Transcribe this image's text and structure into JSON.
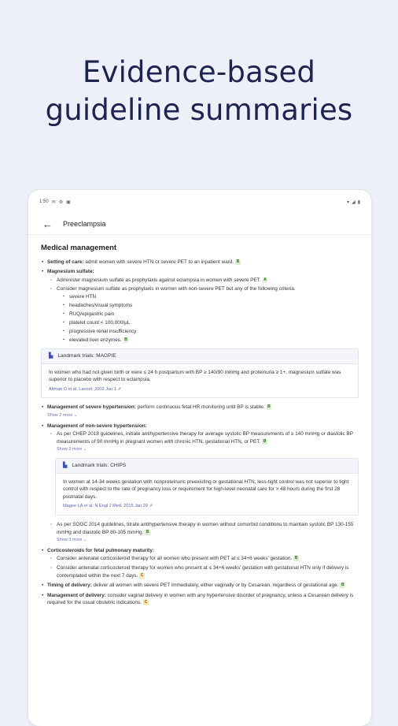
{
  "headline": {
    "line1": "Evidence-based",
    "line2": "guideline summaries"
  },
  "status": {
    "time": "1:50",
    "icons_left": [
      "mail-icon",
      "settings-icon",
      "image-icon"
    ],
    "icons_right": [
      "wifi-icon",
      "signal-icon",
      "battery-icon"
    ]
  },
  "appbar": {
    "back_glyph": "←",
    "title": "Preeclampsia"
  },
  "section": {
    "title": "Medical management"
  },
  "items": {
    "setting": {
      "label": "Setting of care:",
      "text": " admit women with severe HTN or severe PET to an inpatient ward.",
      "badge": "B"
    },
    "mag": {
      "label": "Magnesium sulfate:",
      "s1": "Administer magnesium sulfate as prophylaxis against eclampsia in women with severe PET.",
      "s1_badge": "A",
      "s2": "Consider magnesium sulfate as prophylaxis in women with non-severe PET but any of the following criteria:",
      "criteria": [
        "severe HTN",
        "headaches/visual symptoms",
        "RUQ/epigastric pain",
        "platelet count < 100,000/µL",
        "progressive renal insufficiency",
        "elevated liver enzymes."
      ],
      "criteria_badge": "B"
    },
    "trial1": {
      "title": "Landmark trials: MAGPIE",
      "body": "In women who had not given birth or were ≤ 24 h postpartum with BP ≥ 140/90 mmHg and proteinuria ≥ 1+, magnesium sulfate was superior to placebo with respect to eclampsia.",
      "cite": "Altman D et al. Lancet. 2002 Jun 1 ⇗"
    },
    "severe": {
      "label": "Management of severe hypertension:",
      "text": " perform continuous fetal HR monitoring until BP is stable.",
      "badge": "B",
      "more": "Show 2 more ⌄"
    },
    "nonsevere": {
      "label": "Management of non-severe hypertension:",
      "s1": "As per CHEP 2018 guidelines, initiate antihypertensive therapy for average systolic BP measurements of ≥ 140 mmHg or diastolic BP measurements of 90 mmHg in pregnant women with chronic HTN, gestational HTN, or PET.",
      "s1_badge": "B",
      "s1_more": "Show 2 more ⌄",
      "s2": "As per SOGC 2014 guidelines, titrate antihypertensive therapy in women without comorbid conditions to maintain systolic BP 130-155 mmHg and diastolic BP 80-105 mmHg.",
      "s2_badge": "B",
      "s2_more": "Show 3 more ⌄"
    },
    "trial2": {
      "title": "Landmark trials: CHIPS",
      "body": "In women at 14-34 weeks gestation with nonproteinuric preexisting or gestational HTN, less-tight control was not superior to tight control with respect to the rate of pregnancy loss or requirement for high-level neonatal care for > 48 hours during the first 28 postnatal days.",
      "cite": "Magee LA et al. N Engl J Med. 2015 Jan 29 ⇗"
    },
    "cortico": {
      "label": "Corticosteroids for fetal pulmonary maturity:",
      "s1": "Consider antenatal corticosteroid therapy for all women who present with PET at ≤ 34+6 weeks' gestation.",
      "s1_badge": "B",
      "s2": "Consider antenatal corticosteroid therapy for women who present at ≤ 34+6 weeks' gestation with gestational HTN only if delivery is contemplated within the next 7 days.",
      "s2_badge": "C"
    },
    "timing": {
      "label": "Timing of delivery:",
      "text": " deliver all women with severe PET immediately, either vaginally or by Cesarean, regardless of gestational age.",
      "badge": "B"
    },
    "mgmt_delivery": {
      "label": "Management of delivery:",
      "text": " consider vaginal delivery in women with any hypertensive disorder of pregnancy, unless a Cesarean delivery is required for the usual obstetric indications.",
      "badge": "C"
    }
  },
  "colors": {
    "background": "#eef0f9",
    "headline": "#1e2450",
    "badge_green": "#dcefd2",
    "badge_yellow": "#fbe6b8",
    "link": "#5a63b5"
  }
}
